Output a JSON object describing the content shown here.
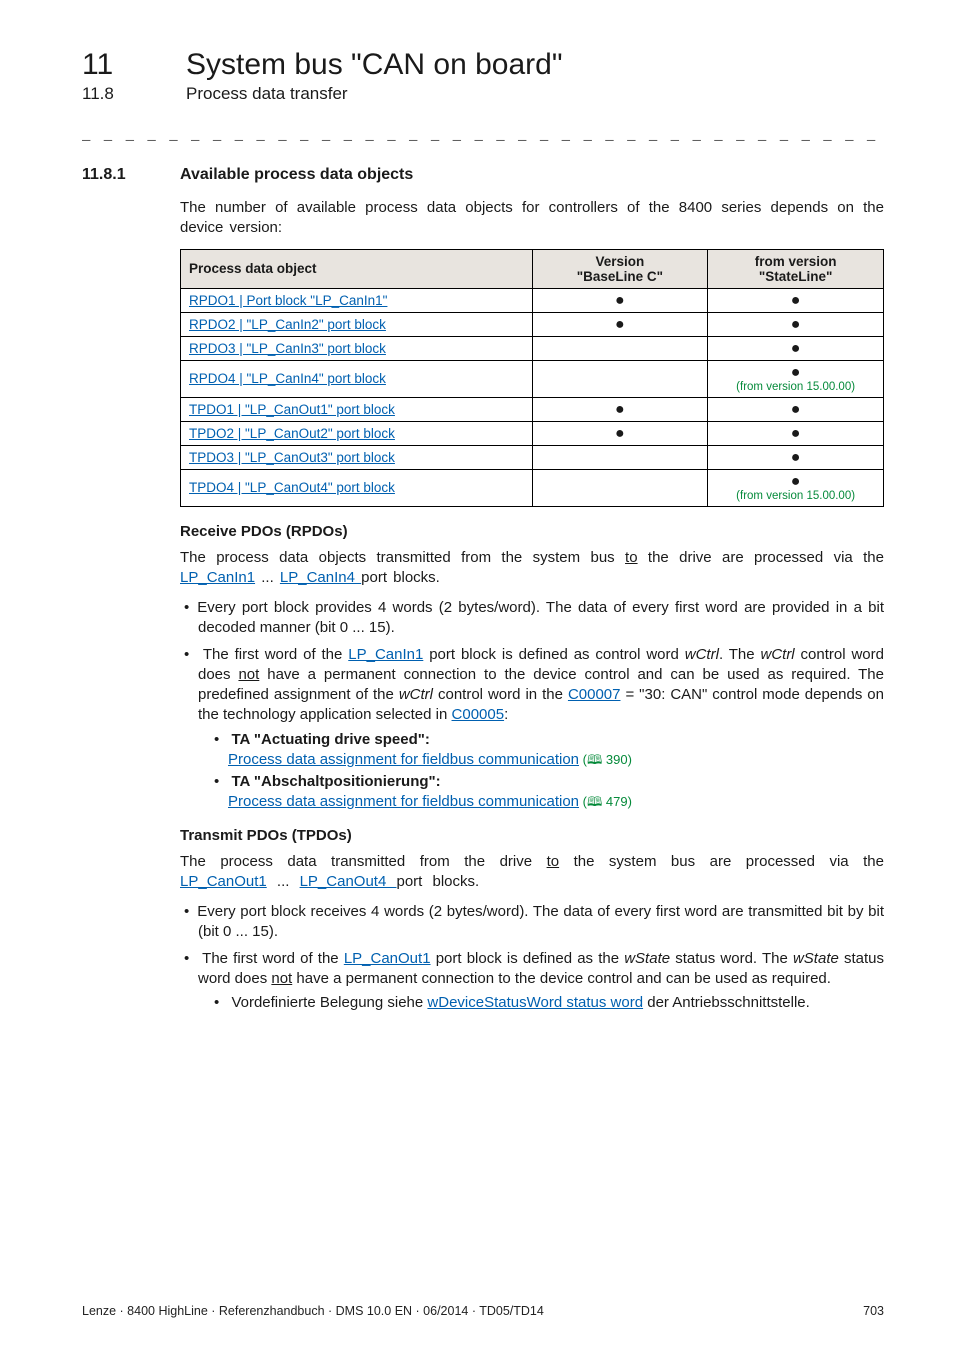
{
  "chapter": {
    "num": "11",
    "title": "System bus \"CAN on board\""
  },
  "subchapter": {
    "num": "11.8",
    "title": "Process data transfer"
  },
  "separator": "_ _ _ _ _ _ _ _ _ _ _ _ _ _ _ _ _ _ _ _ _ _ _ _ _ _ _ _ _ _ _ _ _ _ _ _ _ _ _ _ _ _ _ _ _ _ _ _ _ _ _ _ _ _ _ _ _ _ _ _ _ _ _ _",
  "section": {
    "num": "11.8.1",
    "title": "Available process data objects"
  },
  "intro": "The number of available process data objects for controllers of the 8400 series depends on the device version:",
  "table": {
    "headers": {
      "c1": "Process data object",
      "c2": "Version",
      "c2b": "\"BaseLine C\"",
      "c3": "from version",
      "c3b": "\"StateLine\""
    },
    "rows": [
      {
        "name": "RPDO1 | Port block \"LP_CanIn1\"",
        "baseline": true,
        "stateline": true,
        "note": ""
      },
      {
        "name": "RPDO2 | \"LP_CanIn2\" port block",
        "baseline": true,
        "stateline": true,
        "note": ""
      },
      {
        "name": "RPDO3 | \"LP_CanIn3\" port block",
        "baseline": false,
        "stateline": true,
        "note": ""
      },
      {
        "name": "RPDO4 | \"LP_CanIn4\" port block",
        "baseline": false,
        "stateline": true,
        "note": "(from version 15.00.00)"
      },
      {
        "name": "TPDO1 | \"LP_CanOut1\" port block",
        "baseline": true,
        "stateline": true,
        "note": ""
      },
      {
        "name": "TPDO2 | \"LP_CanOut2\" port block",
        "baseline": true,
        "stateline": true,
        "note": ""
      },
      {
        "name": "TPDO3 | \"LP_CanOut3\" port block",
        "baseline": false,
        "stateline": true,
        "note": ""
      },
      {
        "name": "TPDO4 | \"LP_CanOut4\" port block",
        "baseline": false,
        "stateline": true,
        "note": "(from version 15.00.00)"
      }
    ]
  },
  "rpdo": {
    "heading": "Receive PDOs (RPDOs)",
    "intro_a": "The process data objects transmitted from the system bus ",
    "intro_to": "to",
    "intro_b": " the drive are processed via the ",
    "link1": "LP_CanIn1",
    "intro_c": " ... ",
    "link2": "LP_CanIn4 ",
    "intro_d": " port blocks.",
    "b1": "Every port block provides 4 words (2 bytes/word). The data of every first word are provided in a bit decoded manner (bit 0 ... 15).",
    "b2a": "The first word of the ",
    "b2_link": "LP_CanIn1",
    "b2b": " port block is defined as control word ",
    "b2_wctrl": "wCtrl",
    "b2c": ". The ",
    "b2d": " control word does ",
    "b2_not": "not",
    "b2e": " have a permanent connection to the device control and can be used as required. The predefined assignment of the ",
    "b2f": " control word in the ",
    "b2_c7": "C00007",
    "b2g": " = \"30: CAN\" control mode depends on the technology application selected in ",
    "b2_c5": "C00005",
    "b2h": ":",
    "s1_title": "TA \"Actuating drive speed\":",
    "s1_link": "Process data assignment for fieldbus communication",
    "s1_ref": " (🕮 390)",
    "s2_title": "TA \"Abschaltpositionierung\":",
    "s2_link": "Process data assignment for fieldbus communication",
    "s2_ref": " (🕮 479)"
  },
  "tpdo": {
    "heading": "Transmit PDOs (TPDOs)",
    "intro_a": "The process data transmitted from the drive ",
    "intro_to": "to",
    "intro_b": " the system bus are processed via the ",
    "link1": "LP_CanOut1",
    "intro_c": " ... ",
    "link2": "LP_CanOut4 ",
    "intro_d": " port blocks.",
    "b1": "Every port block receives 4 words (2 bytes/word). The data of every first word are transmitted bit by bit (bit 0 ... 15).",
    "b2a": "The first word of the ",
    "b2_link": "LP_CanOut1",
    "b2b": " port block is defined as the ",
    "b2_wstate": "wState",
    "b2c": " status word. The ",
    "b2d": " status word does ",
    "b2_not": "not",
    "b2e": " have a permanent connection to the device control and can be used as required.",
    "s1a": "Vordefinierte Belegung siehe ",
    "s1_link": "wDeviceStatusWord status word",
    "s1b": " der Antriebsschnittstelle."
  },
  "footer": {
    "left": "Lenze · 8400 HighLine · Referenzhandbuch · DMS 10.0 EN · 06/2014 · TD05/TD14",
    "right": "703"
  }
}
